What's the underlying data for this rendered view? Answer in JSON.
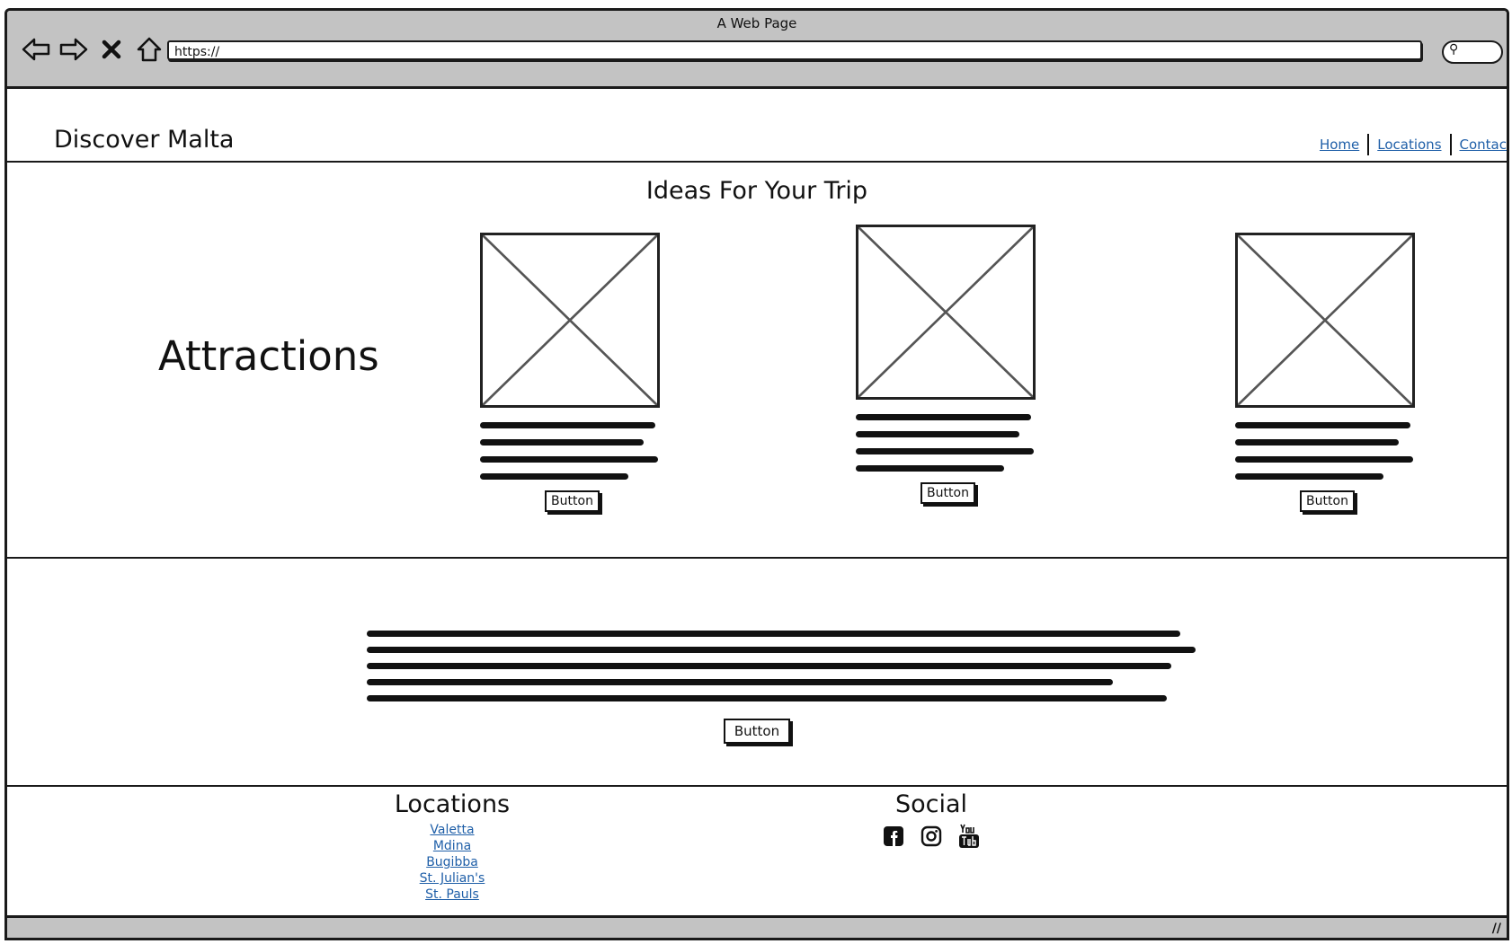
{
  "window": {
    "title": "A Web Page",
    "url": "https://"
  },
  "header": {
    "site_title": "Discover Malta",
    "nav": [
      "Home",
      "Locations",
      "Contac"
    ]
  },
  "ideas": {
    "title": "Ideas For Your Trip",
    "side_heading": "Attractions",
    "cards": [
      {
        "button": "Button"
      },
      {
        "button": "Button"
      },
      {
        "button": "Button"
      }
    ]
  },
  "middle": {
    "button": "Button"
  },
  "footer": {
    "locations_heading": "Locations",
    "locations": [
      "Valetta",
      "Mdina",
      "Bugibba",
      "St. Julian's",
      "St. Pauls"
    ],
    "social_heading": "Social",
    "social_icons": [
      "facebook-icon",
      "instagram-icon",
      "youtube-icon"
    ]
  },
  "colors": {
    "chrome": "#c3c3c3",
    "link": "#1f5fa8"
  }
}
